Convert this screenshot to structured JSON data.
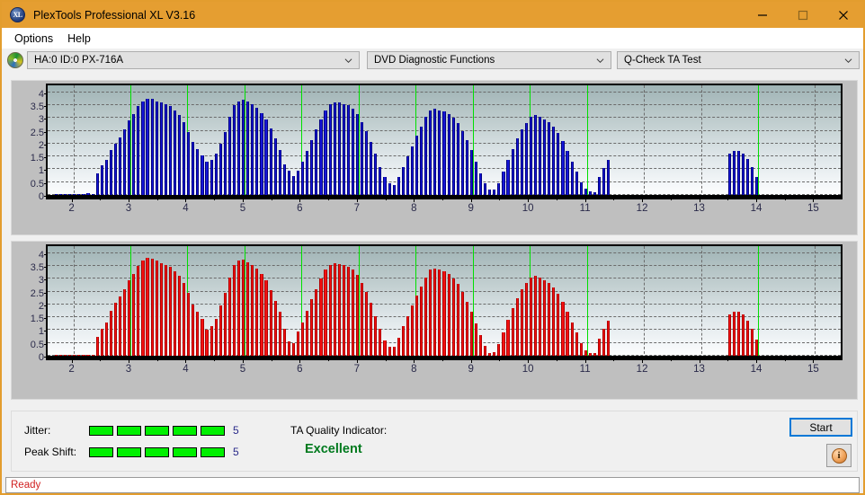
{
  "window": {
    "title": "PlexTools Professional XL V3.16",
    "app_icon": "XL",
    "minimize_label": "Minimize",
    "maximize_label": "Maximize",
    "close_label": "Close",
    "titlebar_color": "#e59e31"
  },
  "menu": {
    "items": [
      {
        "label": "Options"
      },
      {
        "label": "Help"
      }
    ]
  },
  "toolbar": {
    "drive_icon": "disc-icon",
    "drive_select": {
      "value": "HA:0 ID:0  PX-716A"
    },
    "function_select": {
      "value": "DVD Diagnostic Functions"
    },
    "test_select": {
      "value": "Q-Check TA Test"
    }
  },
  "chart_data": [
    {
      "type": "bar",
      "title": "Jitter (blue) vs disc radius",
      "series_name": "Jitter",
      "color": "#1616d8",
      "xlabel": "",
      "ylabel": "",
      "xlim": [
        1.55,
        15.45
      ],
      "ylim": [
        0,
        4.2
      ],
      "yticks": [
        0,
        0.5,
        1,
        1.5,
        2,
        2.5,
        3,
        3.5,
        4
      ],
      "ytick_labels": [
        "0",
        "0.5",
        "1",
        "1.5",
        "2",
        "2.5",
        "3",
        "3.5",
        "4"
      ],
      "xticks": [
        2,
        3,
        4,
        5,
        6,
        7,
        8,
        9,
        10,
        11,
        12,
        13,
        14,
        15
      ],
      "xtick_labels": [
        "2",
        "3",
        "4",
        "5",
        "6",
        "7",
        "8",
        "9",
        "10",
        "11",
        "12",
        "13",
        "14",
        "15"
      ],
      "grid": true,
      "markers": [
        3,
        4,
        5,
        6,
        7,
        8,
        9,
        10,
        11,
        14
      ],
      "marker_color": "#00e000",
      "x": [
        1.7,
        1.78,
        1.86,
        1.94,
        2.02,
        2.1,
        2.18,
        2.26,
        2.34,
        2.42,
        2.5,
        2.58,
        2.66,
        2.74,
        2.82,
        2.9,
        2.98,
        3.06,
        3.14,
        3.22,
        3.3,
        3.38,
        3.46,
        3.54,
        3.62,
        3.7,
        3.78,
        3.86,
        3.94,
        4.02,
        4.1,
        4.18,
        4.26,
        4.34,
        4.42,
        4.5,
        4.58,
        4.66,
        4.74,
        4.82,
        4.9,
        4.98,
        5.06,
        5.14,
        5.22,
        5.3,
        5.38,
        5.46,
        5.54,
        5.62,
        5.7,
        5.78,
        5.86,
        5.94,
        6.02,
        6.1,
        6.18,
        6.26,
        6.34,
        6.42,
        6.5,
        6.58,
        6.66,
        6.74,
        6.82,
        6.9,
        6.98,
        7.06,
        7.14,
        7.22,
        7.3,
        7.38,
        7.46,
        7.54,
        7.62,
        7.7,
        7.78,
        7.86,
        7.94,
        8.02,
        8.1,
        8.18,
        8.26,
        8.34,
        8.42,
        8.5,
        8.58,
        8.66,
        8.74,
        8.82,
        8.9,
        8.98,
        9.06,
        9.14,
        9.22,
        9.3,
        9.38,
        9.46,
        9.54,
        9.62,
        9.7,
        9.78,
        9.86,
        9.94,
        10.02,
        10.1,
        10.18,
        10.26,
        10.34,
        10.42,
        10.5,
        10.58,
        10.66,
        10.74,
        10.82,
        10.9,
        10.98,
        11.06,
        11.14,
        11.22,
        11.3,
        11.38,
        13.5,
        13.58,
        13.66,
        13.74,
        13.82,
        13.9,
        13.98,
        14.06,
        14.14,
        14.22
      ],
      "values": [
        0.05,
        0.05,
        0.02,
        0.05,
        0.04,
        0.03,
        0.05,
        0.06,
        0.04,
        0.85,
        1.15,
        1.35,
        1.75,
        2.0,
        2.25,
        2.55,
        2.9,
        3.15,
        3.45,
        3.65,
        3.75,
        3.75,
        3.65,
        3.6,
        3.55,
        3.45,
        3.3,
        3.1,
        2.85,
        2.45,
        2.05,
        1.8,
        1.55,
        1.3,
        1.35,
        1.6,
        2.0,
        2.45,
        3.05,
        3.5,
        3.65,
        3.7,
        3.65,
        3.55,
        3.4,
        3.2,
        2.95,
        2.6,
        2.2,
        1.75,
        1.2,
        0.95,
        0.75,
        0.95,
        1.3,
        1.7,
        2.15,
        2.55,
        2.95,
        3.3,
        3.55,
        3.6,
        3.6,
        3.55,
        3.5,
        3.35,
        3.15,
        2.85,
        2.5,
        2.05,
        1.6,
        1.1,
        0.7,
        0.45,
        0.4,
        0.7,
        1.1,
        1.5,
        1.9,
        2.3,
        2.65,
        3.05,
        3.3,
        3.35,
        3.3,
        3.25,
        3.15,
        3.0,
        2.8,
        2.5,
        2.15,
        1.75,
        1.3,
        0.85,
        0.45,
        0.2,
        0.2,
        0.45,
        0.9,
        1.35,
        1.8,
        2.2,
        2.55,
        2.8,
        3.05,
        3.1,
        3.05,
        2.95,
        2.85,
        2.65,
        2.4,
        2.1,
        1.7,
        1.3,
        0.9,
        0.5,
        0.25,
        0.15,
        0.1,
        0.7,
        1.05,
        1.35,
        1.6,
        1.7,
        1.7,
        1.6,
        1.4,
        1.1,
        0.7
      ]
    },
    {
      "type": "bar",
      "title": "Peak Shift (red) vs disc radius",
      "series_name": "Peak Shift",
      "color": "#f41111",
      "xlabel": "",
      "ylabel": "",
      "xlim": [
        1.55,
        15.45
      ],
      "ylim": [
        0,
        4.2
      ],
      "yticks": [
        0,
        0.5,
        1,
        1.5,
        2,
        2.5,
        3,
        3.5,
        4
      ],
      "ytick_labels": [
        "0",
        "0.5",
        "1",
        "1.5",
        "2",
        "2.5",
        "3",
        "3.5",
        "4"
      ],
      "xticks": [
        2,
        3,
        4,
        5,
        6,
        7,
        8,
        9,
        10,
        11,
        12,
        13,
        14,
        15
      ],
      "xtick_labels": [
        "2",
        "3",
        "4",
        "5",
        "6",
        "7",
        "8",
        "9",
        "10",
        "11",
        "12",
        "13",
        "14",
        "15"
      ],
      "grid": true,
      "markers": [
        3,
        4,
        5,
        6,
        7,
        8,
        9,
        10,
        11,
        14
      ],
      "marker_color": "#00e000",
      "x": [
        1.7,
        1.78,
        1.86,
        1.94,
        2.02,
        2.1,
        2.18,
        2.26,
        2.34,
        2.42,
        2.5,
        2.58,
        2.66,
        2.74,
        2.82,
        2.9,
        2.98,
        3.06,
        3.14,
        3.22,
        3.3,
        3.38,
        3.46,
        3.54,
        3.62,
        3.7,
        3.78,
        3.86,
        3.94,
        4.02,
        4.1,
        4.18,
        4.26,
        4.34,
        4.42,
        4.5,
        4.58,
        4.66,
        4.74,
        4.82,
        4.9,
        4.98,
        5.06,
        5.14,
        5.22,
        5.3,
        5.38,
        5.46,
        5.54,
        5.62,
        5.7,
        5.78,
        5.86,
        5.94,
        6.02,
        6.1,
        6.18,
        6.26,
        6.34,
        6.42,
        6.5,
        6.58,
        6.66,
        6.74,
        6.82,
        6.9,
        6.98,
        7.06,
        7.14,
        7.22,
        7.3,
        7.38,
        7.46,
        7.54,
        7.62,
        7.7,
        7.78,
        7.86,
        7.94,
        8.02,
        8.1,
        8.18,
        8.26,
        8.34,
        8.42,
        8.5,
        8.58,
        8.66,
        8.74,
        8.82,
        8.9,
        8.98,
        9.06,
        9.14,
        9.22,
        9.3,
        9.38,
        9.46,
        9.54,
        9.62,
        9.7,
        9.78,
        9.86,
        9.94,
        10.02,
        10.1,
        10.18,
        10.26,
        10.34,
        10.42,
        10.5,
        10.58,
        10.66,
        10.74,
        10.82,
        10.9,
        10.98,
        11.06,
        11.14,
        11.22,
        11.3,
        11.38,
        13.5,
        13.58,
        13.66,
        13.74,
        13.82,
        13.9,
        13.98,
        14.06,
        14.14,
        14.22
      ],
      "values": [
        0.05,
        0.04,
        0.03,
        0.05,
        0.04,
        0.04,
        0.05,
        0.05,
        0.04,
        0.75,
        1.05,
        1.3,
        1.75,
        2.05,
        2.3,
        2.6,
        2.95,
        3.2,
        3.5,
        3.7,
        3.8,
        3.78,
        3.7,
        3.62,
        3.55,
        3.45,
        3.3,
        3.1,
        2.85,
        2.45,
        2.0,
        1.7,
        1.45,
        1.0,
        1.15,
        1.45,
        1.95,
        2.45,
        3.05,
        3.55,
        3.7,
        3.75,
        3.65,
        3.55,
        3.4,
        3.2,
        2.95,
        2.55,
        2.15,
        1.7,
        1.05,
        0.55,
        0.5,
        0.95,
        1.3,
        1.75,
        2.2,
        2.6,
        3.0,
        3.35,
        3.55,
        3.6,
        3.58,
        3.55,
        3.48,
        3.35,
        3.15,
        2.85,
        2.5,
        2.05,
        1.55,
        1.05,
        0.6,
        0.35,
        0.35,
        0.7,
        1.15,
        1.55,
        1.95,
        2.35,
        2.7,
        3.05,
        3.35,
        3.4,
        3.35,
        3.28,
        3.18,
        3.0,
        2.8,
        2.5,
        2.1,
        1.7,
        1.25,
        0.8,
        0.4,
        0.12,
        0.15,
        0.45,
        0.9,
        1.4,
        1.85,
        2.25,
        2.6,
        2.85,
        3.05,
        3.12,
        3.05,
        2.95,
        2.85,
        2.65,
        2.4,
        2.1,
        1.7,
        1.3,
        0.9,
        0.5,
        0.22,
        0.12,
        0.1,
        0.65,
        1.05,
        1.35,
        1.62,
        1.72,
        1.7,
        1.6,
        1.38,
        1.05,
        0.62
      ]
    }
  ],
  "results": {
    "jitter": {
      "label": "Jitter:",
      "value": "5",
      "blocks_filled": 5,
      "blocks_total": 5,
      "block_color": "#00f000"
    },
    "peak_shift": {
      "label": "Peak Shift:",
      "value": "5",
      "blocks_filled": 5,
      "blocks_total": 5,
      "block_color": "#00f000"
    },
    "ta_quality": {
      "label": "TA Quality Indicator:",
      "value": "Excellent",
      "value_color": "#007a1e"
    }
  },
  "actions": {
    "start_label": "Start",
    "info_label": "i"
  },
  "status": {
    "text": "Ready",
    "color": "#d02020"
  }
}
